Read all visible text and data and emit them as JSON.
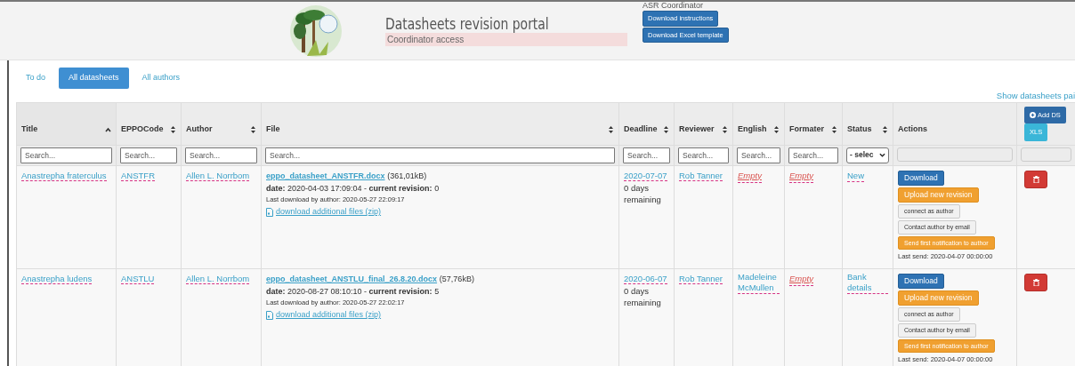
{
  "header": {
    "title": "Datasheets revision portal",
    "subtitle": "Coordinator access",
    "user_label": "ASR Coordinator",
    "buttons": [
      "Download instructions",
      "Download Excel template"
    ]
  },
  "tabs": [
    {
      "label": "To do",
      "selected": false
    },
    {
      "label": "All datasheets",
      "selected": true
    },
    {
      "label": "All authors",
      "selected": false
    }
  ],
  "show_link": "Show datasheets pai",
  "table": {
    "columns": [
      {
        "label": "Title",
        "sortable": true,
        "sorted_ascending": true
      },
      {
        "label": "EPPOCode",
        "sortable": true,
        "sorted_ascending": false
      },
      {
        "label": "Author",
        "sortable": true,
        "sorted_ascending": false
      },
      {
        "label": "File",
        "sortable": true,
        "sorted_ascending": false
      },
      {
        "label": "Deadline",
        "sortable": true,
        "sorted_ascending": false
      },
      {
        "label": "Reviewer",
        "sortable": true,
        "sorted_ascending": false
      },
      {
        "label": "English",
        "sortable": true,
        "sorted_ascending": false
      },
      {
        "label": "Formater",
        "sortable": true,
        "sorted_ascending": false
      },
      {
        "label": "Status",
        "sortable": true,
        "sorted_ascending": false
      },
      {
        "label": "Actions",
        "sortable": false,
        "sorted_ascending": false
      }
    ],
    "header_buttons": [
      {
        "label": "Add DS",
        "kind": "add"
      },
      {
        "label": "XLS",
        "kind": "xls"
      }
    ],
    "filters": [
      {
        "kind": "text",
        "placeholder": "Search..."
      },
      {
        "kind": "text",
        "placeholder": "Search..."
      },
      {
        "kind": "text",
        "placeholder": "Search..."
      },
      {
        "kind": "text",
        "placeholder": "Search..."
      },
      {
        "kind": "text",
        "placeholder": "Search..."
      },
      {
        "kind": "text",
        "placeholder": "Search..."
      },
      {
        "kind": "text",
        "placeholder": "Search..."
      },
      {
        "kind": "text",
        "placeholder": "Search..."
      },
      {
        "kind": "select",
        "value": "- selec"
      },
      {
        "kind": "blank"
      },
      {
        "kind": "blank"
      }
    ],
    "rows": [
      {
        "title": "Anastrepha fraterculus",
        "code": "ANSTFR",
        "author": "Allen L. Norrbom",
        "file_name": "eppo_datasheet_ANSTFR.docx",
        "file_size": "(361,01kB)",
        "file_info": "**date:** 2020-04-03 17:09:04 - **current revision:** 0",
        "last_download": "Last download by author: 2020-05-27 22:09:17",
        "additional": "download additional files (zip)",
        "deadline": "2020-07-07",
        "remaining": "0 days remaining",
        "reviewer": "Rob Tanner",
        "english": {
          "text": "Empty",
          "empty": true
        },
        "formater": {
          "text": "Empty",
          "empty": true
        },
        "status": "New",
        "actions": [
          {
            "label": "Download",
            "kind": "primary"
          },
          {
            "label": "Upload new revision",
            "kind": "warning"
          },
          {
            "label": "connect as author",
            "kind": "light"
          },
          {
            "label": "Contact author by email",
            "kind": "light"
          },
          {
            "label": "Send first notification to author",
            "kind": "warning-small"
          }
        ],
        "last_send": "Last send: 2020-04-07 00:00:00"
      },
      {
        "title": "Anastrepha ludens",
        "code": "ANSTLU",
        "author": "Allen L. Norrbom",
        "file_name": "eppo_datasheet_ANSTLU_final_26.8.20.docx",
        "file_size": "(57,76kB)",
        "file_info": "**date:** 2020-08-27 08:10:10 - **current revision:** 5",
        "last_download": "Last download by author: 2020-05-27 22:02:17",
        "additional": "download additional files (zip)",
        "deadline": "2020-06-07",
        "remaining": "0 days remaining",
        "reviewer": "Rob Tanner",
        "english": {
          "text": "Madeleine McMullen",
          "empty": false
        },
        "formater": {
          "text": "Empty",
          "empty": true
        },
        "status": "Bank details",
        "actions": [
          {
            "label": "Download",
            "kind": "primary"
          },
          {
            "label": "Upload new revision",
            "kind": "warning"
          },
          {
            "label": "connect as author",
            "kind": "light"
          },
          {
            "label": "Contact author by email",
            "kind": "light"
          },
          {
            "label": "Send first notification to author",
            "kind": "warning-small"
          }
        ],
        "last_send": "Last send: 2020-04-07 00:00:00"
      }
    ]
  }
}
